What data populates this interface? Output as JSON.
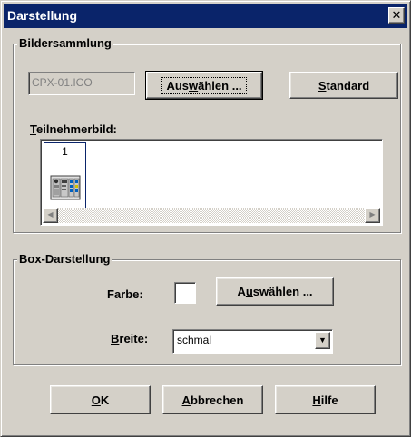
{
  "window": {
    "title": "Darstellung",
    "close_glyph": "✕"
  },
  "bildersammlung": {
    "group_label": "Bildersammlung",
    "file_value": "CPX-01.ICO",
    "select_pre": "Aus",
    "select_mnemonic": "w",
    "select_post": "ählen ...",
    "standard_mnemonic": "S",
    "standard_post": "tandard",
    "teilnehmer_mnemonic": "T",
    "teilnehmer_post": "eilnehmerbild:",
    "items": [
      {
        "number": "1"
      }
    ],
    "scroll_left": "◀",
    "scroll_right": "▶"
  },
  "box": {
    "group_label": "Box-Darstellung",
    "farbe_label": "Farbe:",
    "farbe_select_pre": "A",
    "farbe_select_mnemonic": "u",
    "farbe_select_post": "swählen ...",
    "breite_mnemonic": "B",
    "breite_post": "reite:",
    "breite_value": "schmal",
    "dropdown_glyph": "▼"
  },
  "footer": {
    "ok_mnemonic": "O",
    "ok_post": "K",
    "cancel_mnemonic": "A",
    "cancel_post": "bbrechen",
    "help_mnemonic": "H",
    "help_post": "ilfe"
  }
}
